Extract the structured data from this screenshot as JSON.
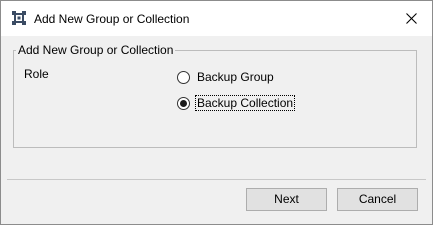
{
  "window": {
    "title": "Add New Group or Collection",
    "icon": "app-logo-icon",
    "close_icon": "close-icon"
  },
  "group": {
    "legend": "Add New Group or Collection",
    "role_label": "Role",
    "options": [
      {
        "label": "Backup Group",
        "checked": false
      },
      {
        "label": "Backup Collection",
        "checked": true
      }
    ]
  },
  "footer": {
    "next_label": "Next",
    "cancel_label": "Cancel"
  },
  "colors": {
    "icon": "#3a4b63",
    "dialog_bg": "#f0f0f0",
    "button_bg": "#e1e1e1"
  }
}
